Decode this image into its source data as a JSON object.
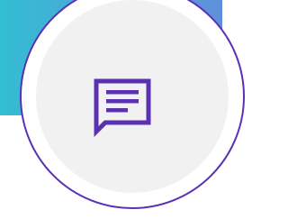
{
  "colors": {
    "banner_start": "#33bdd3",
    "banner_end": "#5f8fdc",
    "accent": "#5a31b3",
    "circle_fill": "#f1f1f1",
    "background": "#ffffff"
  },
  "icon": {
    "name": "message-icon"
  }
}
